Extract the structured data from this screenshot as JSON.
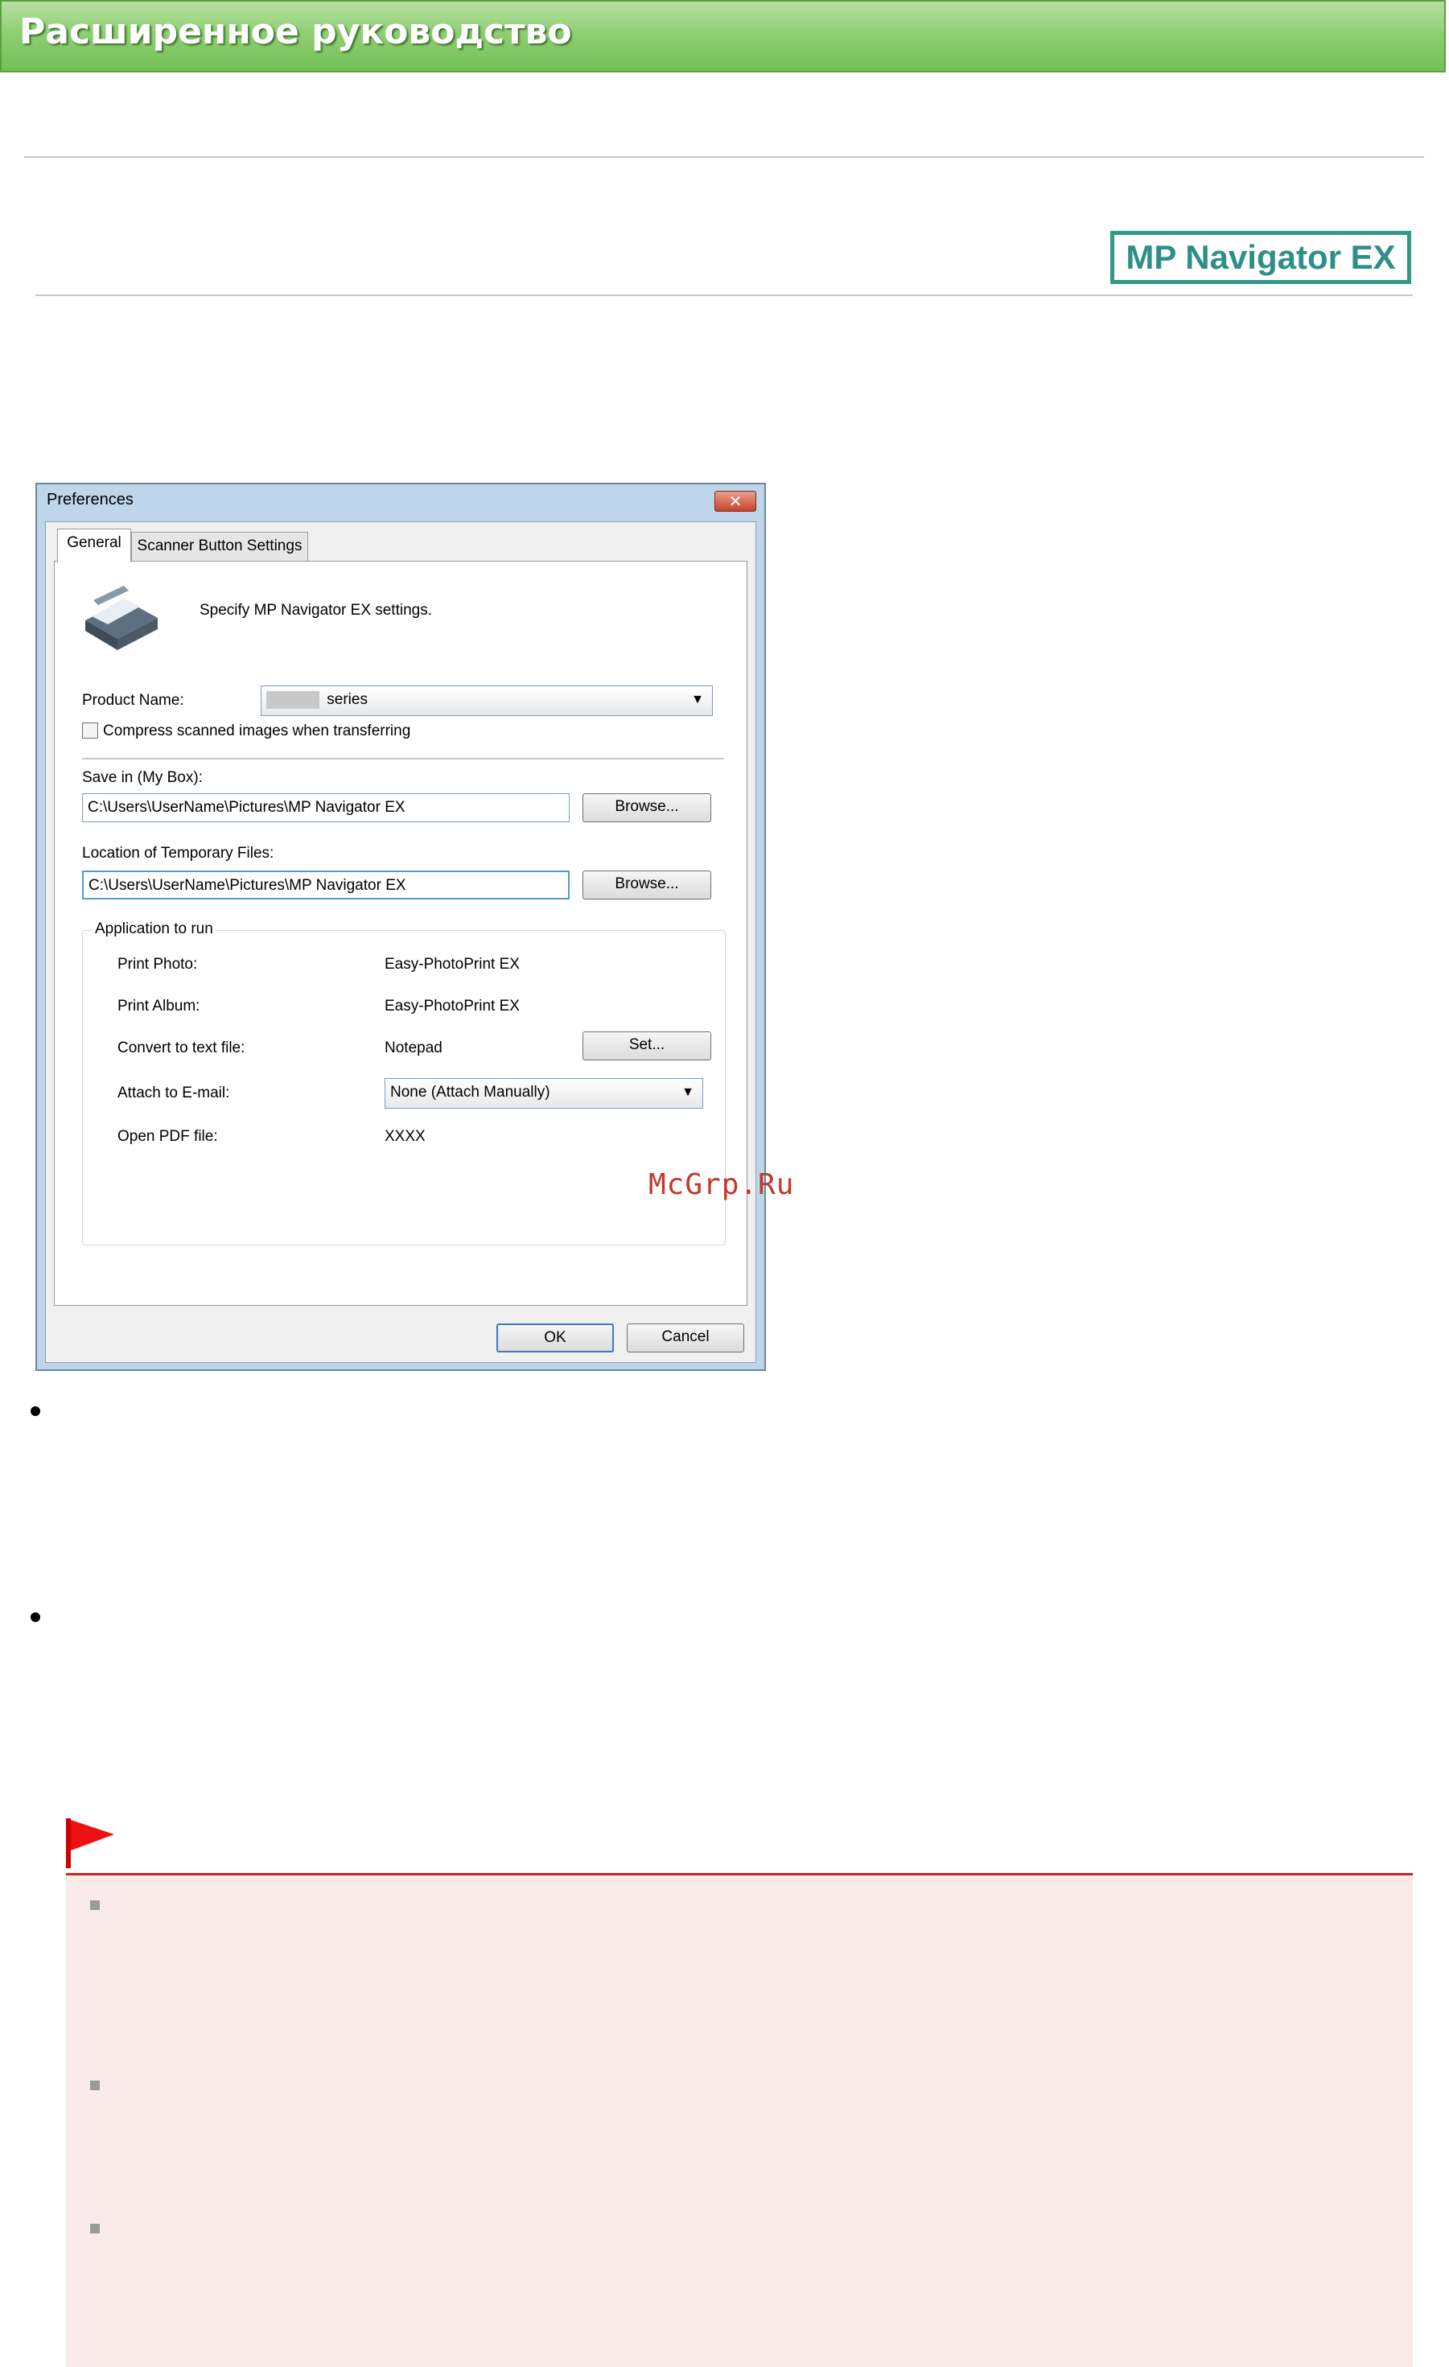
{
  "header": {
    "title": "Расширенное руководство"
  },
  "logo": {
    "text": "MP Navigator EX"
  },
  "dialog": {
    "title": "Preferences",
    "close_glyph": "✕",
    "tabs": [
      {
        "label": "General"
      },
      {
        "label": "Scanner Button Settings"
      }
    ],
    "intro_text": "Specify MP Navigator EX settings.",
    "product_name_label": "Product Name:",
    "product_name_value": "series",
    "compress_label": "Compress scanned images when transferring",
    "save_in_label": "Save in (My Box):",
    "save_in_value": "C:\\Users\\UserName\\Pictures\\MP Navigator EX",
    "temp_label": "Location of Temporary Files:",
    "temp_value": "C:\\Users\\UserName\\Pictures\\MP Navigator EX",
    "browse_label": "Browse...",
    "app_group": {
      "title": "Application to run",
      "rows": [
        {
          "label": "Print Photo:",
          "value": "Easy-PhotoPrint EX"
        },
        {
          "label": "Print Album:",
          "value": "Easy-PhotoPrint EX"
        },
        {
          "label": "Convert to text file:",
          "value": "Notepad"
        },
        {
          "label": "Attach to E-mail:",
          "value": "None (Attach Manually)"
        },
        {
          "label": "Open PDF file:",
          "value": "XXXX"
        }
      ],
      "set_label": "Set..."
    },
    "ok_label": "OK",
    "cancel_label": "Cancel",
    "dropdown_arrow": "▼"
  },
  "watermark": "McGrp.Ru",
  "colors": {
    "banner": "#8fcf74",
    "logo_border": "#2f9b86",
    "caution_bg": "#fbeaea",
    "caution_line": "#cc2222"
  }
}
